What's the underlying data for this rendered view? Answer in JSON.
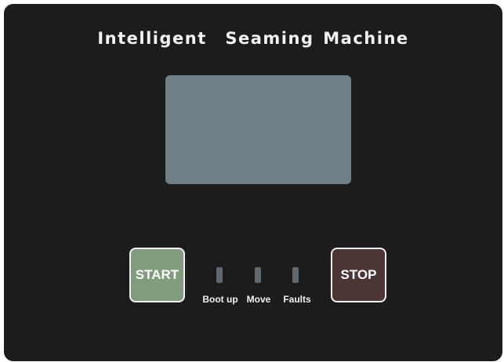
{
  "machine": {
    "title": "Intelligent  Seaming Machine"
  },
  "controls": {
    "start_label": "START",
    "stop_label": "STOP"
  },
  "indicators": [
    {
      "label": "Boot up",
      "state": "off"
    },
    {
      "label": "Move",
      "state": "off"
    },
    {
      "label": "Faults",
      "state": "off"
    }
  ],
  "colors": {
    "panel": "#1c1c1c",
    "display": "#6f7f88",
    "start_button": "#7f9c7c",
    "stop_button": "#4d3535",
    "indicator_off": "#5e6a70"
  }
}
